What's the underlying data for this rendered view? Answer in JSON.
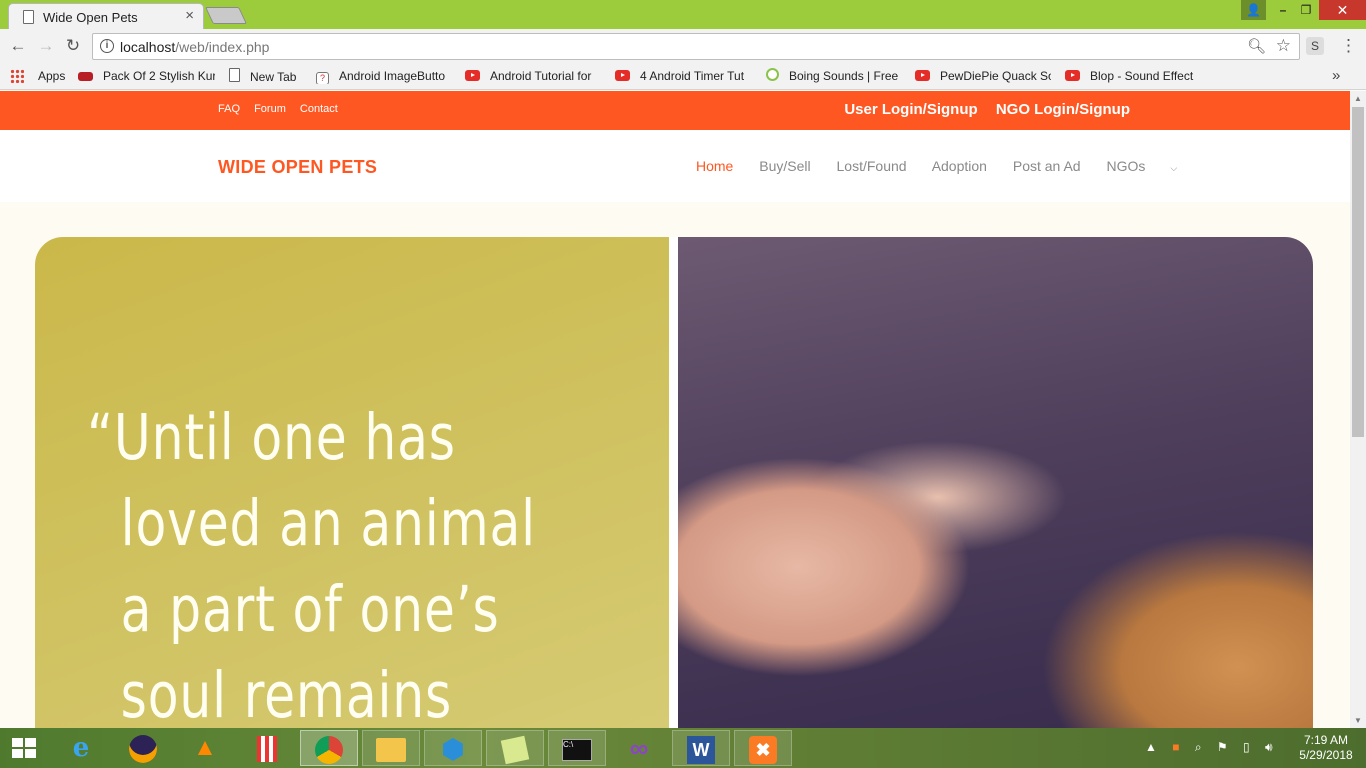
{
  "browser": {
    "tab_title": "Wide Open Pets",
    "tab_close": "×",
    "url_host": "localhost",
    "url_path": "/web/index.php",
    "extension_label": "S"
  },
  "bookmarks": [
    {
      "label": "Apps",
      "icon": "apps-grid-icon"
    },
    {
      "label": "Pack Of 2 Stylish Kur",
      "icon": "shop-icon"
    },
    {
      "label": "New Tab",
      "icon": "page-icon"
    },
    {
      "label": "Android ImageButto",
      "icon": "help-page-icon"
    },
    {
      "label": "Android Tutorial for",
      "icon": "youtube-icon"
    },
    {
      "label": "4 Android Timer Tut",
      "icon": "youtube-icon"
    },
    {
      "label": "Boing Sounds | Free",
      "icon": "boing-icon"
    },
    {
      "label": "PewDiePie Quack So",
      "icon": "youtube-icon"
    },
    {
      "label": "Blop - Sound Effect",
      "icon": "youtube-icon"
    }
  ],
  "site": {
    "top_links": [
      "FAQ",
      "Forum",
      "Contact"
    ],
    "login_links": [
      "User Login/Signup",
      "NGO Login/Signup"
    ],
    "brand": "WIDE OPEN PETS",
    "nav": [
      "Home",
      "Buy/Sell",
      "Lost/Found",
      "Adoption",
      "Post an Ad",
      "NGOs"
    ],
    "active_nav": "Home",
    "accent_color": "#ff5722",
    "hero_quote": "“Until one has\n  loved an animal\n  a part of one’s\n  soul remains"
  },
  "taskbar": {
    "apps": [
      "internet-explorer",
      "eclipse",
      "vlc",
      "popcorn-time",
      "chrome",
      "file-explorer",
      "visual-studio-code",
      "sticky-notes",
      "command-prompt",
      "visual-studio",
      "word",
      "xampp"
    ],
    "time": "7:19 AM",
    "date": "5/29/2018"
  }
}
